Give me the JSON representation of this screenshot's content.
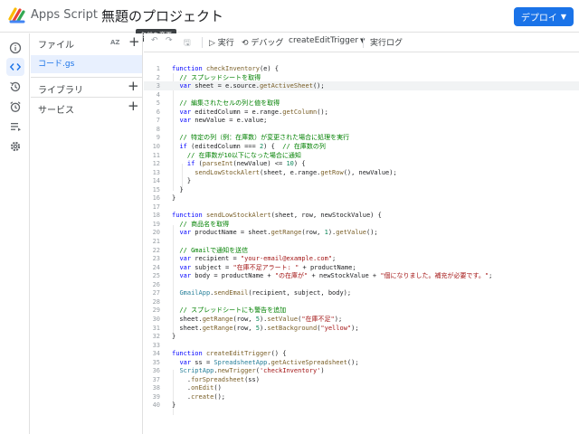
{
  "header": {
    "brand": "Apps Script",
    "project_title": "無題のプロジェクト",
    "deploy_label": "デプロイ",
    "deploy_caret": "▼"
  },
  "tooltip": "名前を変更",
  "rail": {
    "icons": [
      "info-icon",
      "code-icon",
      "history-icon",
      "alarm-icon",
      "list-icon",
      "gear-icon"
    ]
  },
  "files": {
    "title": "ファイル",
    "sort_label": "AZ",
    "add": "+",
    "items": [
      {
        "label": "コード.gs"
      }
    ],
    "sections": [
      {
        "label": "ライブラリ",
        "add": "+"
      },
      {
        "label": "サービス",
        "add": "+"
      }
    ]
  },
  "toolbar": {
    "undo": "↶",
    "redo": "↷",
    "save": "🖫",
    "run": "▷ 実行",
    "debug": "⟲ デバッグ",
    "function_select": "createEditTrigger",
    "function_caret": "▼",
    "log": "実行ログ"
  },
  "colors": {
    "accent": "#1a73e8",
    "selected_bg": "#e8f0fe",
    "keyword": "#0000ff",
    "comment": "#008000",
    "string": "#a31515",
    "number": "#098658"
  },
  "editor": {
    "current_line": 3,
    "lines": [
      [
        {
          "t": "function ",
          "c": "k"
        },
        {
          "t": "checkInventory",
          "c": "p"
        },
        {
          "t": "(e) {",
          "c": ""
        }
      ],
      [
        {
          "t": "  // スプレッドシートを取得",
          "c": "c"
        }
      ],
      [
        {
          "t": "  ",
          "c": ""
        },
        {
          "t": "var",
          "c": "k"
        },
        {
          "t": " sheet = e.source.",
          "c": ""
        },
        {
          "t": "getActiveSheet",
          "c": "p"
        },
        {
          "t": "();",
          "c": ""
        }
      ],
      [
        {
          "t": "",
          "c": ""
        }
      ],
      [
        {
          "t": "  // 編集されたセルの列と値を取得",
          "c": "c"
        }
      ],
      [
        {
          "t": "  ",
          "c": ""
        },
        {
          "t": "var",
          "c": "k"
        },
        {
          "t": " editedColumn = e.range.",
          "c": ""
        },
        {
          "t": "getColumn",
          "c": "p"
        },
        {
          "t": "();",
          "c": ""
        }
      ],
      [
        {
          "t": "  ",
          "c": ""
        },
        {
          "t": "var",
          "c": "k"
        },
        {
          "t": " newValue = e.value;",
          "c": ""
        }
      ],
      [
        {
          "t": "",
          "c": ""
        }
      ],
      [
        {
          "t": "  // 特定の列（例：在庫数）が変更された場合に処理を実行",
          "c": "c"
        }
      ],
      [
        {
          "t": "  ",
          "c": ""
        },
        {
          "t": "if",
          "c": "k"
        },
        {
          "t": " (editedColumn === ",
          "c": ""
        },
        {
          "t": "2",
          "c": "n"
        },
        {
          "t": ") {  ",
          "c": ""
        },
        {
          "t": "// 在庫数の列",
          "c": "c"
        }
      ],
      [
        {
          "t": "    // 在庫数が10以下になった場合に通知",
          "c": "c"
        }
      ],
      [
        {
          "t": "    ",
          "c": ""
        },
        {
          "t": "if",
          "c": "k"
        },
        {
          "t": " (",
          "c": ""
        },
        {
          "t": "parseInt",
          "c": "p"
        },
        {
          "t": "(newValue) <= ",
          "c": ""
        },
        {
          "t": "10",
          "c": "n"
        },
        {
          "t": ") {",
          "c": ""
        }
      ],
      [
        {
          "t": "      ",
          "c": ""
        },
        {
          "t": "sendLowStockAlert",
          "c": "p"
        },
        {
          "t": "(sheet, e.range.",
          "c": ""
        },
        {
          "t": "getRow",
          "c": "p"
        },
        {
          "t": "(), newValue);",
          "c": ""
        }
      ],
      [
        {
          "t": "    }",
          "c": ""
        }
      ],
      [
        {
          "t": "  }",
          "c": ""
        }
      ],
      [
        {
          "t": "}",
          "c": ""
        }
      ],
      [
        {
          "t": "",
          "c": ""
        }
      ],
      [
        {
          "t": "function ",
          "c": "k"
        },
        {
          "t": "sendLowStockAlert",
          "c": "p"
        },
        {
          "t": "(sheet, row, newStockValue) {",
          "c": ""
        }
      ],
      [
        {
          "t": "  // 商品名を取得",
          "c": "c"
        }
      ],
      [
        {
          "t": "  ",
          "c": ""
        },
        {
          "t": "var",
          "c": "k"
        },
        {
          "t": " productName = sheet.",
          "c": ""
        },
        {
          "t": "getRange",
          "c": "p"
        },
        {
          "t": "(row, ",
          "c": ""
        },
        {
          "t": "1",
          "c": "n"
        },
        {
          "t": ").",
          "c": ""
        },
        {
          "t": "getValue",
          "c": "p"
        },
        {
          "t": "();",
          "c": ""
        }
      ],
      [
        {
          "t": "",
          "c": ""
        }
      ],
      [
        {
          "t": "  // Gmailで通知を送信",
          "c": "c"
        }
      ],
      [
        {
          "t": "  ",
          "c": ""
        },
        {
          "t": "var",
          "c": "k"
        },
        {
          "t": " recipient = ",
          "c": ""
        },
        {
          "t": "\"your-email@example.com\"",
          "c": "s"
        },
        {
          "t": ";",
          "c": ""
        }
      ],
      [
        {
          "t": "  ",
          "c": ""
        },
        {
          "t": "var",
          "c": "k"
        },
        {
          "t": " subject = ",
          "c": ""
        },
        {
          "t": "\"在庫不足アラート: \"",
          "c": "s"
        },
        {
          "t": " + productName;",
          "c": ""
        }
      ],
      [
        {
          "t": "  ",
          "c": ""
        },
        {
          "t": "var",
          "c": "k"
        },
        {
          "t": " body = productName + ",
          "c": ""
        },
        {
          "t": "\"の在庫が\"",
          "c": "s"
        },
        {
          "t": " + newStockValue + ",
          "c": ""
        },
        {
          "t": "\"個になりました。補充が必要です。\"",
          "c": "s"
        },
        {
          "t": ";",
          "c": ""
        }
      ],
      [
        {
          "t": "",
          "c": ""
        }
      ],
      [
        {
          "t": "  ",
          "c": ""
        },
        {
          "t": "GmailApp",
          "c": "cl"
        },
        {
          "t": ".",
          "c": ""
        },
        {
          "t": "sendEmail",
          "c": "p"
        },
        {
          "t": "(recipient, subject, body);",
          "c": ""
        }
      ],
      [
        {
          "t": "",
          "c": ""
        }
      ],
      [
        {
          "t": "  // スプレッドシートにも警告を追加",
          "c": "c"
        }
      ],
      [
        {
          "t": "  sheet.",
          "c": ""
        },
        {
          "t": "getRange",
          "c": "p"
        },
        {
          "t": "(row, ",
          "c": ""
        },
        {
          "t": "5",
          "c": "n"
        },
        {
          "t": ").",
          "c": ""
        },
        {
          "t": "setValue",
          "c": "p"
        },
        {
          "t": "(",
          "c": ""
        },
        {
          "t": "\"在庫不足\"",
          "c": "s"
        },
        {
          "t": ");",
          "c": ""
        }
      ],
      [
        {
          "t": "  sheet.",
          "c": ""
        },
        {
          "t": "getRange",
          "c": "p"
        },
        {
          "t": "(row, ",
          "c": ""
        },
        {
          "t": "5",
          "c": "n"
        },
        {
          "t": ").",
          "c": ""
        },
        {
          "t": "setBackground",
          "c": "p"
        },
        {
          "t": "(",
          "c": ""
        },
        {
          "t": "\"yellow\"",
          "c": "s"
        },
        {
          "t": ");",
          "c": ""
        }
      ],
      [
        {
          "t": "}",
          "c": ""
        }
      ],
      [
        {
          "t": "",
          "c": ""
        }
      ],
      [
        {
          "t": "function ",
          "c": "k"
        },
        {
          "t": "createEditTrigger",
          "c": "p"
        },
        {
          "t": "() {",
          "c": ""
        }
      ],
      [
        {
          "t": "  ",
          "c": ""
        },
        {
          "t": "var",
          "c": "k"
        },
        {
          "t": " ss = ",
          "c": ""
        },
        {
          "t": "SpreadsheetApp",
          "c": "cl"
        },
        {
          "t": ".",
          "c": ""
        },
        {
          "t": "getActiveSpreadsheet",
          "c": "p"
        },
        {
          "t": "();",
          "c": ""
        }
      ],
      [
        {
          "t": "  ",
          "c": ""
        },
        {
          "t": "ScriptApp",
          "c": "cl"
        },
        {
          "t": ".",
          "c": ""
        },
        {
          "t": "newTrigger",
          "c": "p"
        },
        {
          "t": "(",
          "c": ""
        },
        {
          "t": "'checkInventory'",
          "c": "s"
        },
        {
          "t": ")",
          "c": ""
        }
      ],
      [
        {
          "t": "    .",
          "c": ""
        },
        {
          "t": "forSpreadsheet",
          "c": "p"
        },
        {
          "t": "(ss)",
          "c": ""
        }
      ],
      [
        {
          "t": "    .",
          "c": ""
        },
        {
          "t": "onEdit",
          "c": "p"
        },
        {
          "t": "()",
          "c": ""
        }
      ],
      [
        {
          "t": "    .",
          "c": ""
        },
        {
          "t": "create",
          "c": "p"
        },
        {
          "t": "();",
          "c": ""
        }
      ],
      [
        {
          "t": "}",
          "c": ""
        }
      ]
    ]
  }
}
